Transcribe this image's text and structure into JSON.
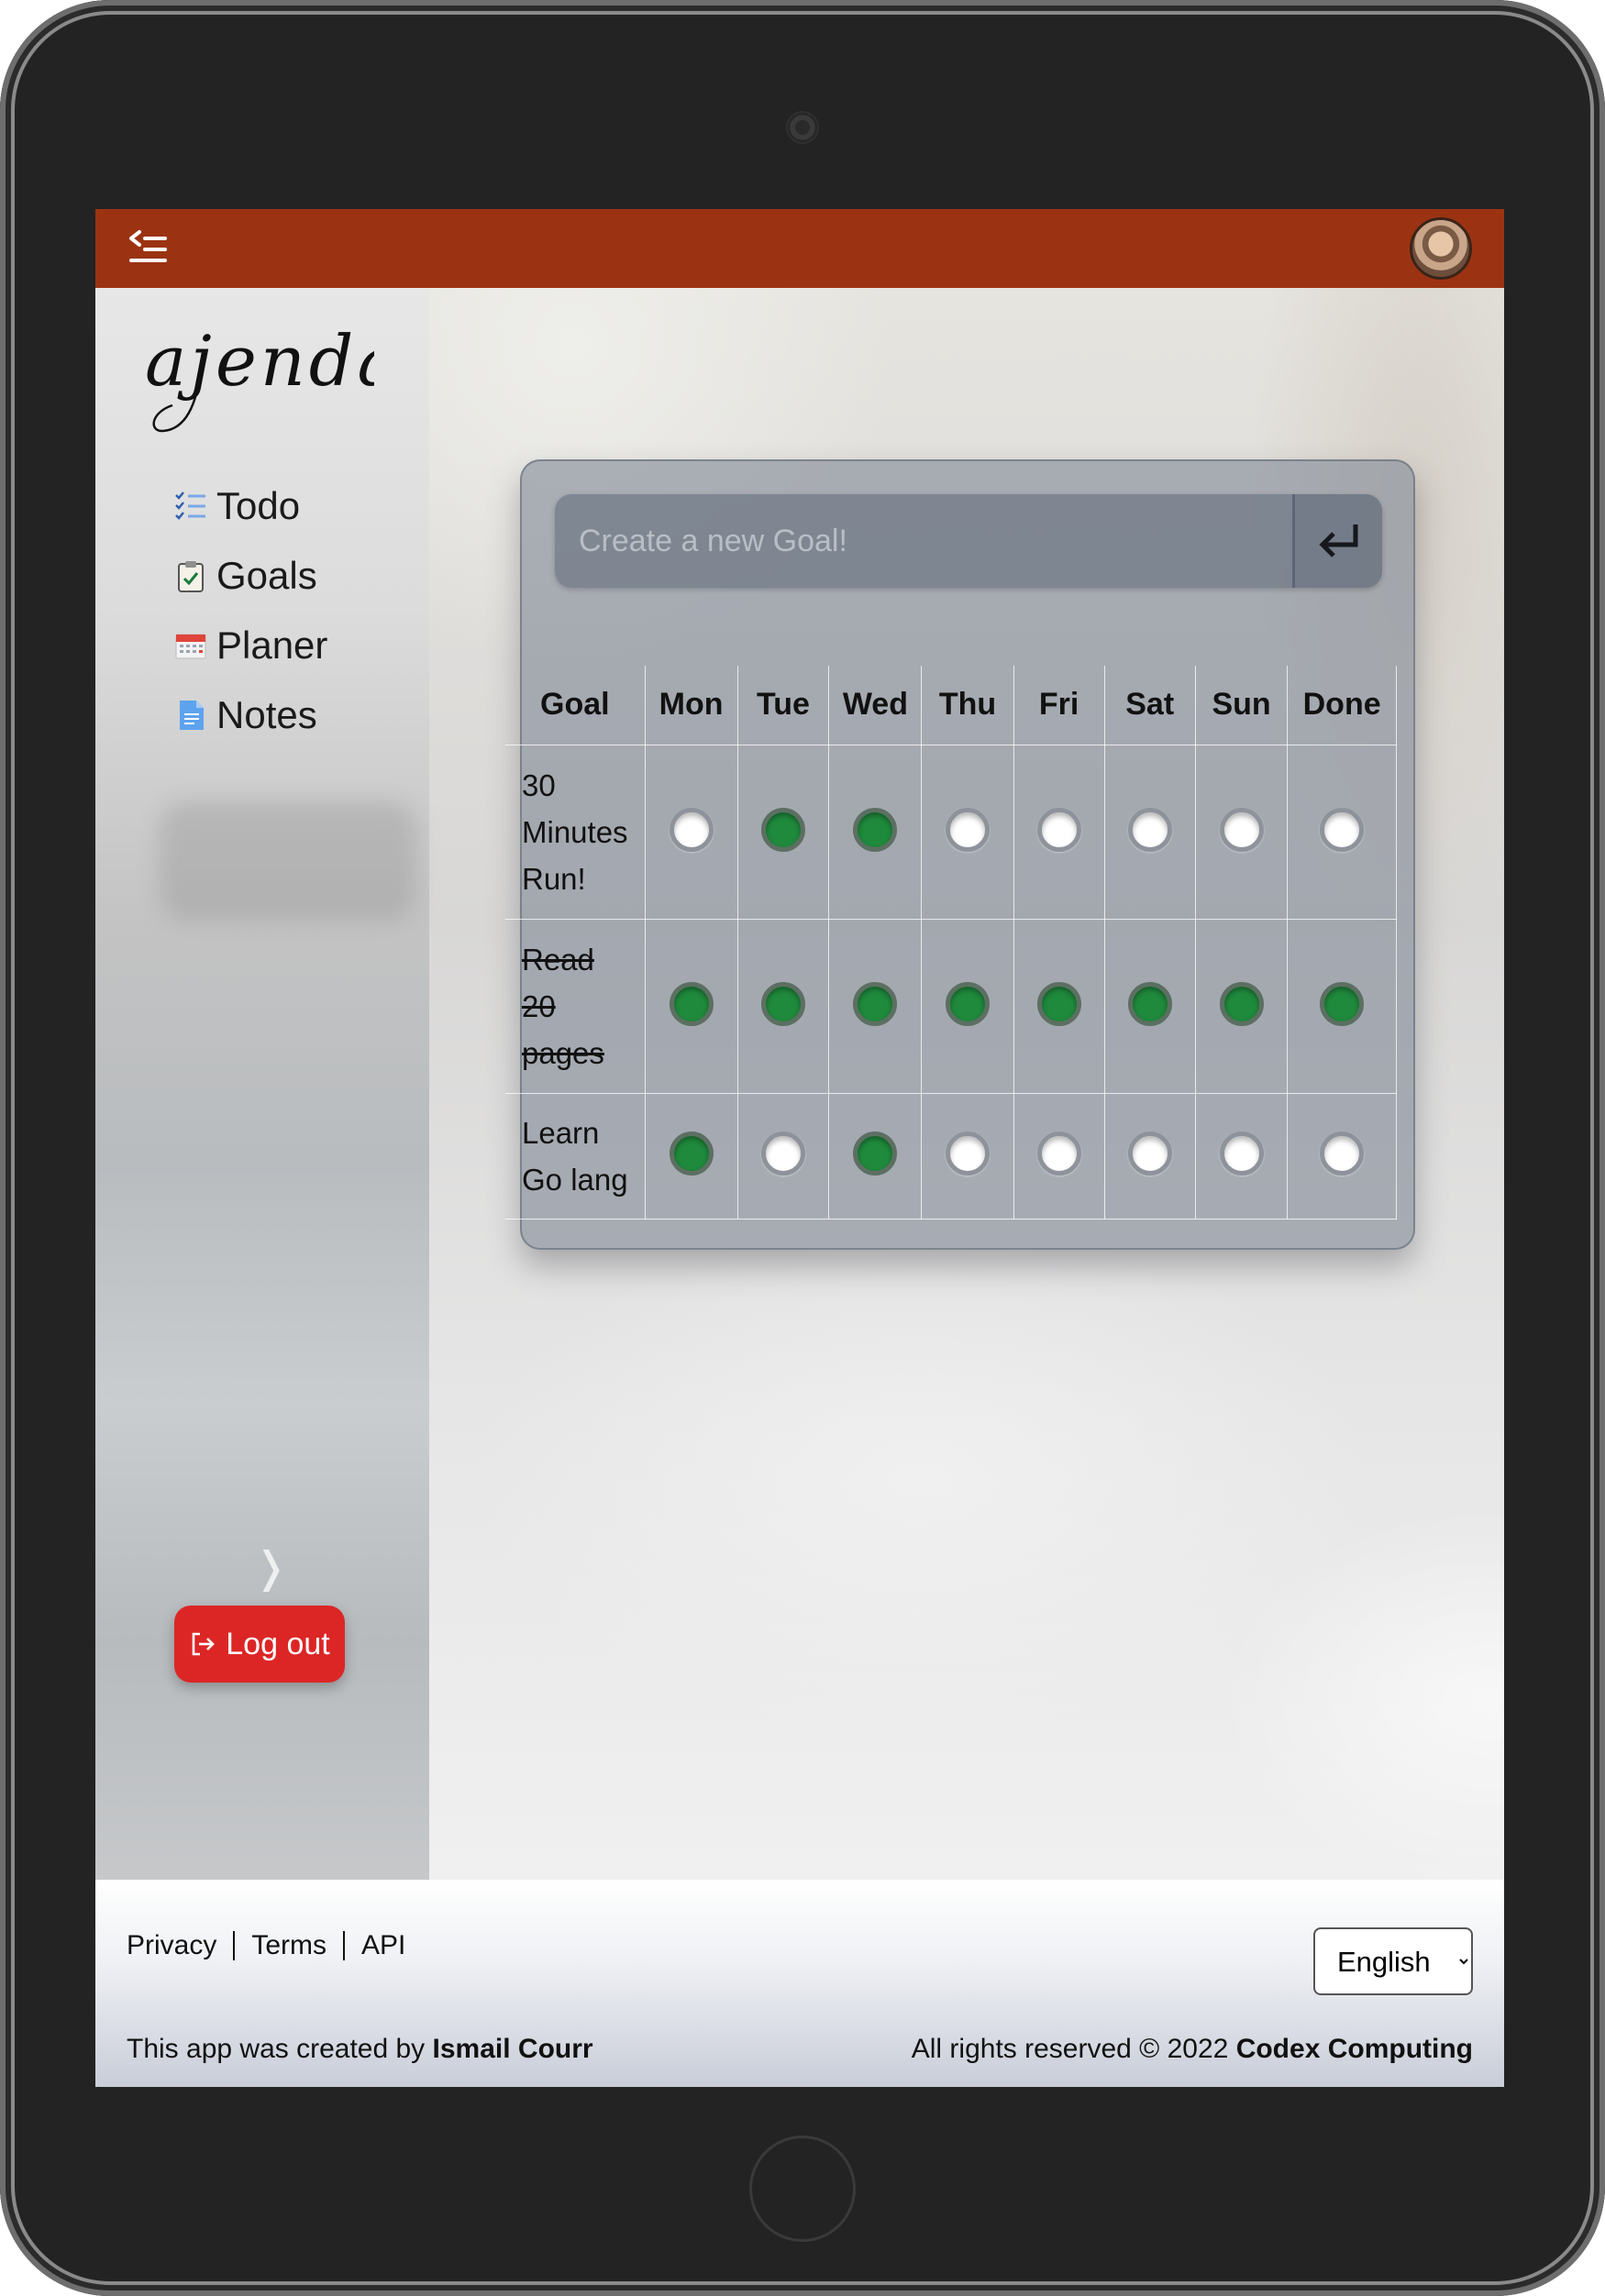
{
  "app": {
    "logo_text": "ajenda"
  },
  "sidebar": {
    "items": [
      {
        "label": "Todo",
        "icon": "checklist-icon"
      },
      {
        "label": "Goals",
        "icon": "clipboard-check-icon"
      },
      {
        "label": "Planer",
        "icon": "calendar-icon"
      },
      {
        "label": "Notes",
        "icon": "document-icon"
      }
    ],
    "collapse_glyph": "❭",
    "logout_label": "Log out"
  },
  "goals": {
    "input_placeholder": "Create a new Goal!",
    "submit_icon": "enter-return-icon",
    "columns": [
      "Goal",
      "Mon",
      "Tue",
      "Wed",
      "Thu",
      "Fri",
      "Sat",
      "Sun",
      "Done"
    ],
    "rows": [
      {
        "lines": [
          "30",
          "Minutes",
          "Run!"
        ],
        "completed": false,
        "checks": [
          false,
          true,
          true,
          false,
          false,
          false,
          false
        ],
        "done": false
      },
      {
        "lines": [
          "Read",
          "20",
          "pages"
        ],
        "completed": true,
        "checks": [
          true,
          true,
          true,
          true,
          true,
          true,
          true
        ],
        "done": true
      },
      {
        "lines": [
          "Learn",
          "Go lang"
        ],
        "completed": false,
        "checks": [
          true,
          false,
          true,
          false,
          false,
          false,
          false
        ],
        "done": false
      }
    ]
  },
  "footer": {
    "links": [
      "Privacy",
      "Terms",
      "API"
    ],
    "language": "English",
    "credit_prefix": "This app was created by ",
    "credit_author": "Ismail Courr",
    "rights_prefix": "All rights reserved © 2022 ",
    "rights_company": "Codex Computing"
  },
  "colors": {
    "topbar": "#9b3312",
    "logout": "#dc2626",
    "check_on": "#1f8a3c"
  }
}
